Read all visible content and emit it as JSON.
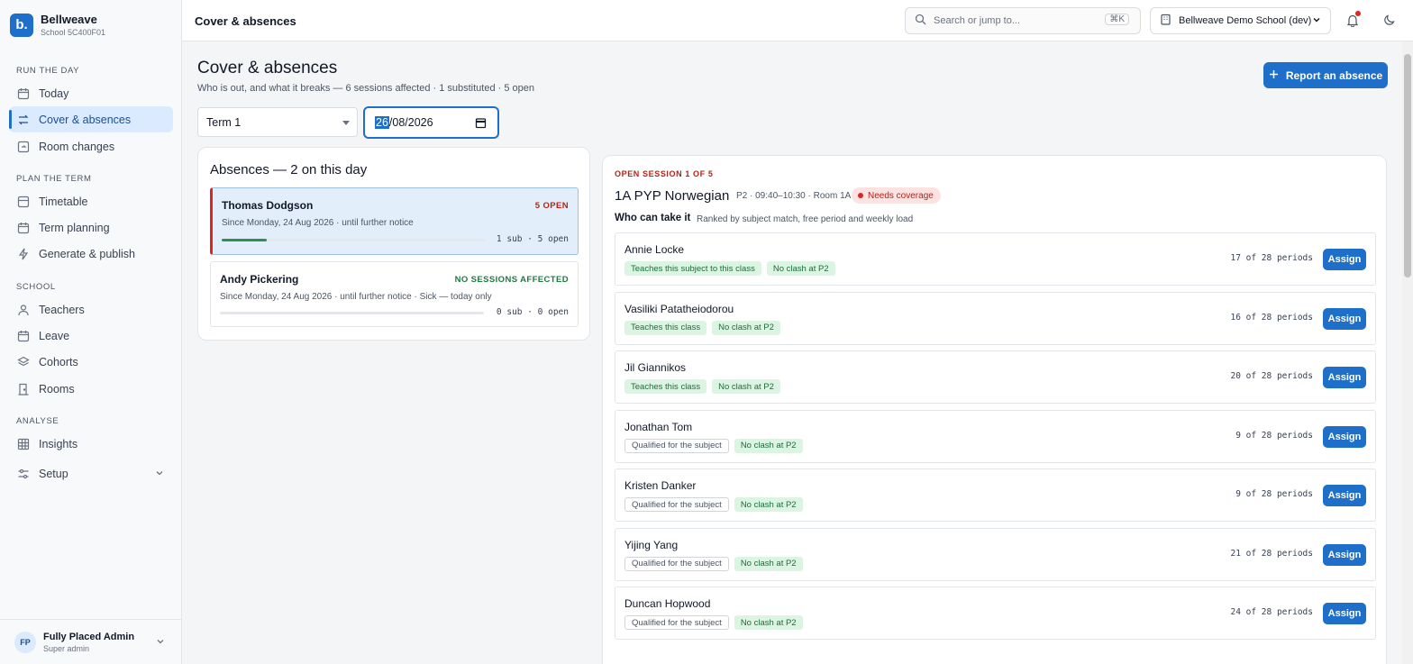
{
  "brand": {
    "logo": "b.",
    "name": "Bellweave",
    "school_code": "School 5C400F01"
  },
  "sidebar": {
    "sections": [
      {
        "label": "RUN THE DAY"
      },
      {
        "label": "PLAN THE TERM"
      },
      {
        "label": "SCHOOL"
      },
      {
        "label": "ANALYSE"
      }
    ],
    "items": [
      {
        "label": "Today",
        "icon": "calendar-icon"
      },
      {
        "label": "Cover & absences",
        "icon": "swap-icon",
        "active": true
      },
      {
        "label": "Room changes",
        "icon": "room-change-icon"
      },
      {
        "label": "Timetable",
        "icon": "timetable-icon"
      },
      {
        "label": "Term planning",
        "icon": "calendar-icon"
      },
      {
        "label": "Generate & publish",
        "icon": "bolt-icon"
      },
      {
        "label": "Teachers",
        "icon": "person-icon"
      },
      {
        "label": "Leave",
        "icon": "calendar-icon"
      },
      {
        "label": "Cohorts",
        "icon": "layers-icon"
      },
      {
        "label": "Rooms",
        "icon": "door-icon"
      },
      {
        "label": "Insights",
        "icon": "grid-icon"
      },
      {
        "label": "Setup",
        "icon": "sliders-icon"
      }
    ],
    "user": {
      "initials": "FP",
      "name": "Fully Placed Admin",
      "role": "Super admin"
    }
  },
  "topbar": {
    "title": "Cover & absences",
    "search_placeholder": "Search or jump to...",
    "search_shortcut": "⌘K",
    "school_selector": "Bellweave Demo School (dev)"
  },
  "main": {
    "title": "Cover & absences",
    "subtitle": "Who is out, and what it breaks — 6 sessions affected · 1 substituted · 5 open",
    "report_button": "Report an absence",
    "term_select": "Term 1",
    "date": {
      "day": "26",
      "rest": "/08/2026"
    }
  },
  "absences": {
    "title": "Absences — 2 on this day",
    "items": [
      {
        "name": "Thomas Dodgson",
        "badge": "5 OPEN",
        "badge_color": "#b42318",
        "meta": "Since Monday, 24 Aug 2026 · until further notice",
        "count": "1 sub · 5 open",
        "progress": 0.17
      },
      {
        "name": "Andy Pickering",
        "badge": "NO SESSIONS AFFECTED",
        "badge_color": "#1f7a43",
        "meta": "Since Monday, 24 Aug 2026 · until further notice · Sick — today only",
        "count": "0 sub · 0 open",
        "progress": 0
      }
    ]
  },
  "session": {
    "kicker": "OPEN SESSION 1 OF 5",
    "title": "1A PYP Norwegian",
    "meta": "P2 · 09:40–10:30 · Room 1A",
    "status": "Needs coverage",
    "who_title": "Who can take it",
    "who_sub": "Ranked by subject match, free period and weekly load",
    "assign_label": "Assign",
    "candidates": [
      {
        "name": "Annie Locke",
        "chips": [
          {
            "text": "Teaches this subject to this class",
            "style": "green"
          },
          {
            "text": "No clash at P2",
            "style": "green"
          }
        ],
        "load": "17 of 28 periods"
      },
      {
        "name": "Vasiliki Patatheiodorou",
        "chips": [
          {
            "text": "Teaches this class",
            "style": "green"
          },
          {
            "text": "No clash at P2",
            "style": "green"
          }
        ],
        "load": "16 of 28 periods"
      },
      {
        "name": "Jil Giannikos",
        "chips": [
          {
            "text": "Teaches this class",
            "style": "green"
          },
          {
            "text": "No clash at P2",
            "style": "green"
          }
        ],
        "load": "20 of 28 periods"
      },
      {
        "name": "Jonathan Tom",
        "chips": [
          {
            "text": "Qualified for the subject",
            "style": "grey"
          },
          {
            "text": "No clash at P2",
            "style": "green"
          }
        ],
        "load": "9 of 28 periods"
      },
      {
        "name": "Kristen Danker",
        "chips": [
          {
            "text": "Qualified for the subject",
            "style": "grey"
          },
          {
            "text": "No clash at P2",
            "style": "green"
          }
        ],
        "load": "9 of 28 periods"
      },
      {
        "name": "Yijing Yang",
        "chips": [
          {
            "text": "Qualified for the subject",
            "style": "grey"
          },
          {
            "text": "No clash at P2",
            "style": "green"
          }
        ],
        "load": "21 of 28 periods"
      },
      {
        "name": "Duncan Hopwood",
        "chips": [
          {
            "text": "Qualified for the subject",
            "style": "grey"
          },
          {
            "text": "No clash at P2",
            "style": "green"
          }
        ],
        "load": "24 of 28 periods"
      }
    ]
  }
}
